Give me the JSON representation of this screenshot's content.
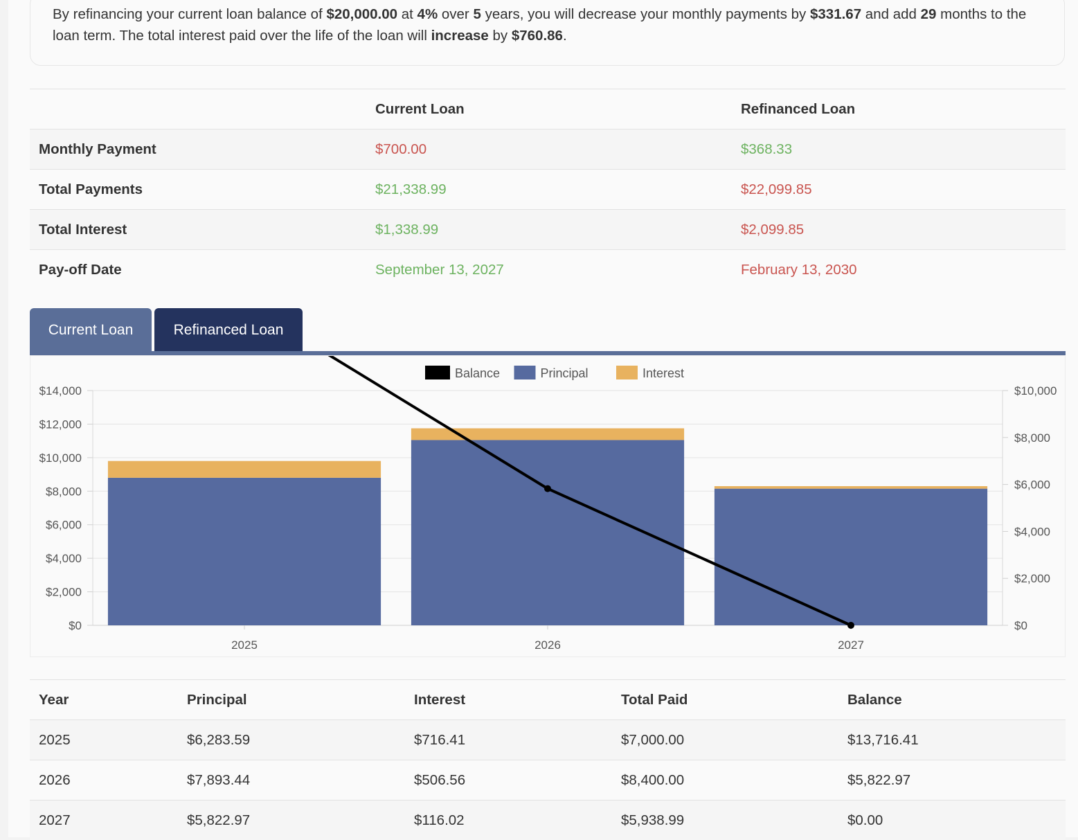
{
  "summary": {
    "p1": "By refinancing your current loan balance of ",
    "balance": "$20,000.00",
    "p2": " at ",
    "rate": "4%",
    "p3": " over ",
    "years": "5",
    "p4": " years, you will decrease your monthly payments by ",
    "decrease": "$331.67",
    "p5": " and add ",
    "months": "29",
    "p6": " months to the loan term. The total interest paid over the life of the loan will ",
    "direction": "increase",
    "p7": " by ",
    "interest_change": "$760.86",
    "p8": "."
  },
  "comparison": {
    "headers": [
      "",
      "Current Loan",
      "Refinanced Loan"
    ],
    "rows": [
      {
        "label": "Monthly Payment",
        "current": "$700.00",
        "refinanced": "$368.33"
      },
      {
        "label": "Total Payments",
        "current": "$21,338.99",
        "refinanced": "$22,099.85"
      },
      {
        "label": "Total Interest",
        "current": "$1,338.99",
        "refinanced": "$2,099.85"
      },
      {
        "label": "Pay-off Date",
        "current": "September 13, 2027",
        "refinanced": "February 13, 2030"
      }
    ],
    "colors": {
      "worse": "#c9544f",
      "better": "#6cb25f"
    }
  },
  "tabs": [
    {
      "label": "Current Loan",
      "active": false
    },
    {
      "label": "Refinanced Loan",
      "active": true
    }
  ],
  "chart_data": {
    "type": "bar",
    "categories": [
      "2025",
      "2026",
      "2027"
    ],
    "series": [
      {
        "name": "Balance",
        "type": "line",
        "axis": "right",
        "color": "#000000",
        "values": [
          13716.41,
          5822.97,
          0
        ]
      },
      {
        "name": "Principal",
        "type": "bar",
        "axis": "left",
        "color": "#566a9f",
        "values": [
          8800,
          11050,
          8150
        ]
      },
      {
        "name": "Interest",
        "type": "bar",
        "axis": "left",
        "color": "#e8b25f",
        "values": [
          1000,
          700,
          150
        ]
      }
    ],
    "stacked": true,
    "ylim_left": [
      0,
      14000
    ],
    "ylim_right": [
      0,
      10000
    ],
    "yticks_left": [
      "$0",
      "$2,000",
      "$4,000",
      "$6,000",
      "$8,000",
      "$10,000",
      "$12,000",
      "$14,000"
    ],
    "yticks_right": [
      "$0",
      "$2,000",
      "$4,000",
      "$6,000",
      "$8,000",
      "$10,000"
    ],
    "legend": "top-center",
    "grid": true
  },
  "yearly": {
    "headers": [
      "Year",
      "Principal",
      "Interest",
      "Total Paid",
      "Balance"
    ],
    "rows": [
      [
        "2025",
        "$6,283.59",
        "$716.41",
        "$7,000.00",
        "$13,716.41"
      ],
      [
        "2026",
        "$7,893.44",
        "$506.56",
        "$8,400.00",
        "$5,822.97"
      ],
      [
        "2027",
        "$5,822.97",
        "$116.02",
        "$5,938.99",
        "$0.00"
      ]
    ]
  }
}
